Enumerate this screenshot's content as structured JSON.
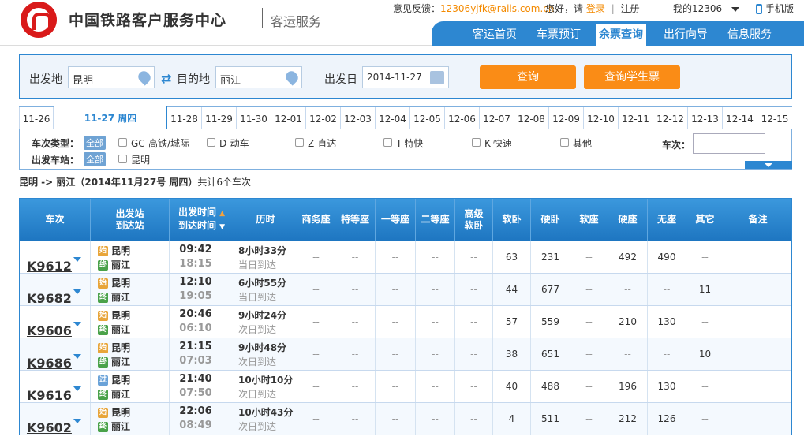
{
  "header": {
    "brand": "中国铁路客户服务中心",
    "sub": "客运服务",
    "feedback_label": "意见反馈：",
    "feedback_email": "12306yjfk@rails.com.cn",
    "greeting": "您好，请",
    "login": "登录",
    "sep": "|",
    "register": "注册",
    "my": "我的12306",
    "mobile": "手机版"
  },
  "nav": [
    "客运首页",
    "车票预订",
    "余票查询",
    "出行向导",
    "信息服务"
  ],
  "query": {
    "from_label": "出发地",
    "from_value": "昆明",
    "to_label": "目的地",
    "to_value": "丽江",
    "date_label": "出发日",
    "date_value": "2014-11-27",
    "search_btn": "查询",
    "student_btn": "查询学生票"
  },
  "dates": [
    "11-26",
    "11-27 周四",
    "11-28",
    "11-29",
    "11-30",
    "12-01",
    "12-02",
    "12-03",
    "12-04",
    "12-05",
    "12-06",
    "12-07",
    "12-08",
    "12-09",
    "12-10",
    "12-11",
    "12-12",
    "12-13",
    "12-14",
    "12-15"
  ],
  "filter": {
    "type_label": "车次类型：",
    "all": "全部",
    "types": [
      "GC-高铁/城际",
      "D-动车",
      "Z-直达",
      "T-特快",
      "K-快速",
      "其他"
    ],
    "station_label": "出发车站：",
    "stations": [
      "昆明"
    ],
    "train_no_label": "车次："
  },
  "summary": {
    "route": "昆明 -> 丽江（2014年11月27号 周四）",
    "count": "共计6个车次"
  },
  "table": {
    "headers": {
      "train": "车次",
      "station1": "出发站",
      "station2": "到达站",
      "time1": "出发时间",
      "time2": "到达时间",
      "duration": "历时",
      "seats": [
        "商务座",
        "特等座",
        "一等座",
        "二等座",
        "高级\n软卧",
        "软卧",
        "硬卧",
        "软座",
        "硬座",
        "无座",
        "其它"
      ],
      "remark": "备注"
    },
    "rows": [
      {
        "no": "K9612",
        "from_tag": "始",
        "from": "昆明",
        "to_tag": "终",
        "to": "丽江",
        "dep": "09:42",
        "arr": "18:15",
        "dur": "8小时33分",
        "day": "当日到达",
        "seats": [
          "--",
          "--",
          "--",
          "--",
          "--",
          "63",
          "231",
          "--",
          "492",
          "490",
          "--"
        ]
      },
      {
        "no": "K9682",
        "from_tag": "始",
        "from": "昆明",
        "to_tag": "终",
        "to": "丽江",
        "dep": "12:10",
        "arr": "19:05",
        "dur": "6小时55分",
        "day": "当日到达",
        "seats": [
          "--",
          "--",
          "--",
          "--",
          "--",
          "44",
          "677",
          "--",
          "--",
          "--",
          "11"
        ]
      },
      {
        "no": "K9606",
        "from_tag": "始",
        "from": "昆明",
        "to_tag": "终",
        "to": "丽江",
        "dep": "20:46",
        "arr": "06:10",
        "dur": "9小时24分",
        "day": "次日到达",
        "seats": [
          "--",
          "--",
          "--",
          "--",
          "--",
          "57",
          "559",
          "--",
          "210",
          "130",
          "--"
        ]
      },
      {
        "no": "K9686",
        "from_tag": "始",
        "from": "昆明",
        "to_tag": "终",
        "to": "丽江",
        "dep": "21:15",
        "arr": "07:03",
        "dur": "9小时48分",
        "day": "次日到达",
        "seats": [
          "--",
          "--",
          "--",
          "--",
          "--",
          "38",
          "651",
          "--",
          "--",
          "--",
          "10"
        ]
      },
      {
        "no": "K9616",
        "from_tag": "过",
        "from": "昆明",
        "to_tag": "终",
        "to": "丽江",
        "dep": "21:40",
        "arr": "07:50",
        "dur": "10小时10分",
        "day": "次日到达",
        "seats": [
          "--",
          "--",
          "--",
          "--",
          "--",
          "40",
          "488",
          "--",
          "196",
          "130",
          "--"
        ]
      },
      {
        "no": "K9602",
        "from_tag": "始",
        "from": "昆明",
        "to_tag": "终",
        "to": "丽江",
        "dep": "22:06",
        "arr": "08:49",
        "dur": "10小时43分",
        "day": "次日到达",
        "seats": [
          "--",
          "--",
          "--",
          "--",
          "--",
          "4",
          "511",
          "--",
          "212",
          "126",
          "--"
        ]
      }
    ]
  }
}
